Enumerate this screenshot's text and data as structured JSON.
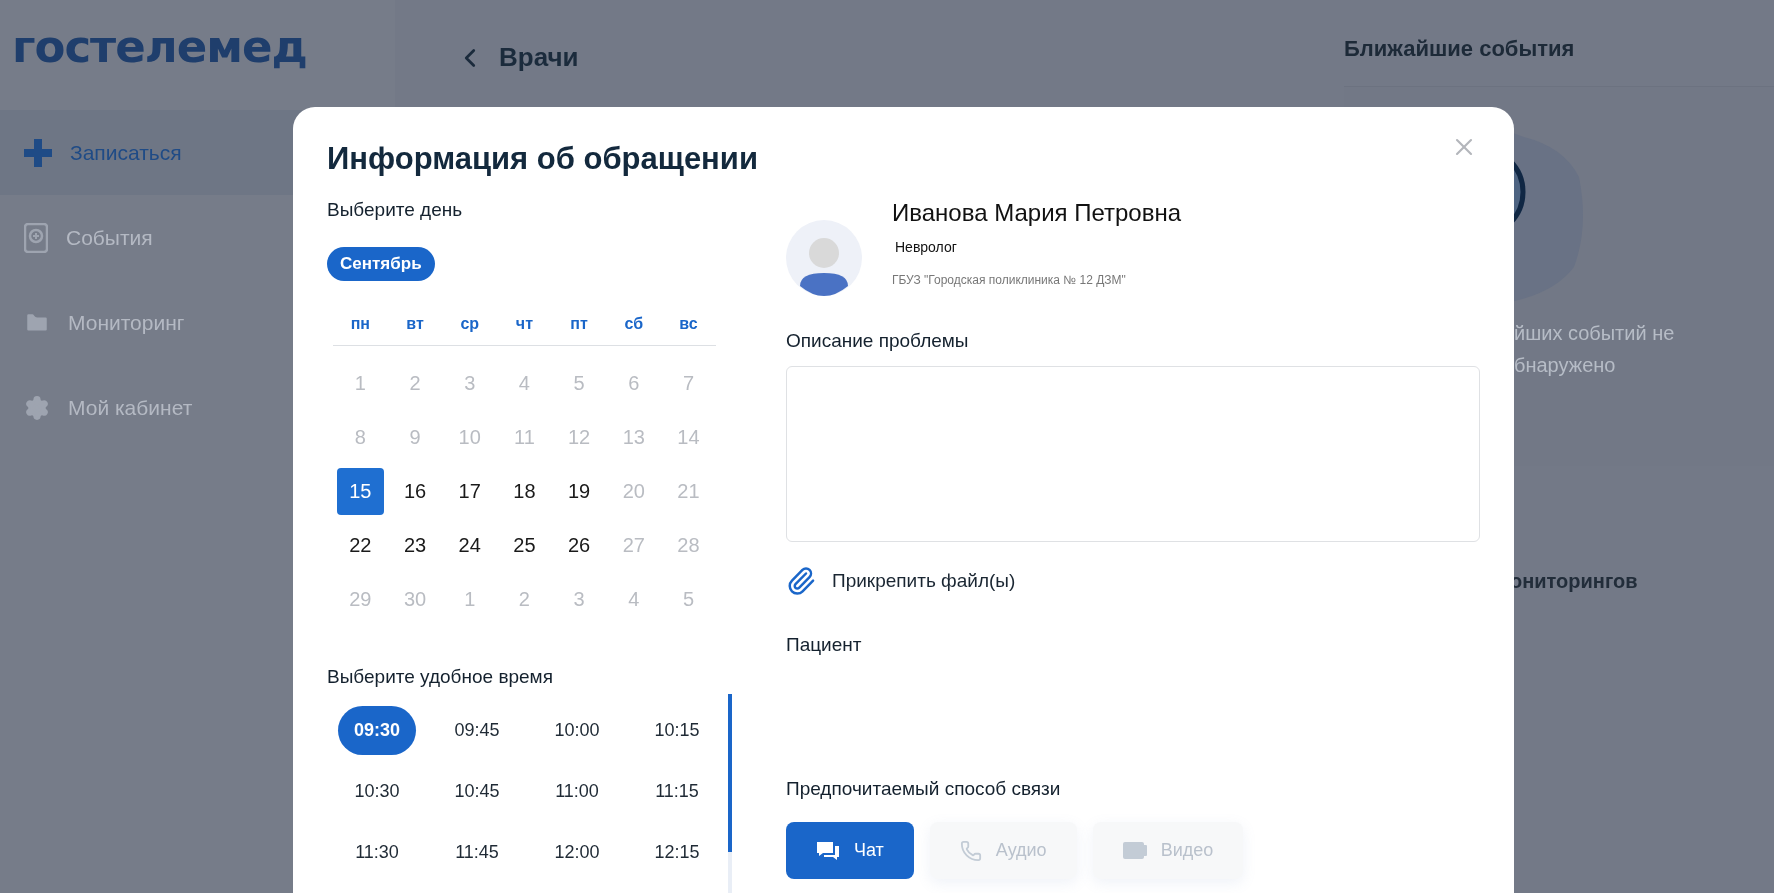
{
  "sidebar": {
    "logo": "гостелемед",
    "items": [
      {
        "label": "Записаться",
        "selected": true
      },
      {
        "label": "События",
        "selected": false
      },
      {
        "label": "Мониторинг",
        "selected": false
      },
      {
        "label": "Мой кабинет",
        "selected": false
      }
    ]
  },
  "header": {
    "title": "Врачи"
  },
  "events_panel": {
    "title": "Ближайшие события",
    "empty_text_lines": [
      "йших событий не",
      "бнаружено"
    ],
    "section_2_title": "ониторингов"
  },
  "modal": {
    "title": "Информация об обращении",
    "day_section": {
      "label": "Выберите день",
      "month": "Сентябрь",
      "weekdays": [
        "пн",
        "вт",
        "ср",
        "чт",
        "пт",
        "сб",
        "вс"
      ],
      "days": [
        {
          "label": "1",
          "available": false,
          "selected": false
        },
        {
          "label": "2",
          "available": false,
          "selected": false
        },
        {
          "label": "3",
          "available": false,
          "selected": false
        },
        {
          "label": "4",
          "available": false,
          "selected": false
        },
        {
          "label": "5",
          "available": false,
          "selected": false
        },
        {
          "label": "6",
          "available": false,
          "selected": false
        },
        {
          "label": "7",
          "available": false,
          "selected": false
        },
        {
          "label": "8",
          "available": false,
          "selected": false
        },
        {
          "label": "9",
          "available": false,
          "selected": false
        },
        {
          "label": "10",
          "available": false,
          "selected": false
        },
        {
          "label": "11",
          "available": false,
          "selected": false
        },
        {
          "label": "12",
          "available": false,
          "selected": false
        },
        {
          "label": "13",
          "available": false,
          "selected": false
        },
        {
          "label": "14",
          "available": false,
          "selected": false
        },
        {
          "label": "15",
          "available": true,
          "selected": true
        },
        {
          "label": "16",
          "available": true,
          "selected": false
        },
        {
          "label": "17",
          "available": true,
          "selected": false
        },
        {
          "label": "18",
          "available": true,
          "selected": false
        },
        {
          "label": "19",
          "available": true,
          "selected": false
        },
        {
          "label": "20",
          "available": false,
          "selected": false
        },
        {
          "label": "21",
          "available": false,
          "selected": false
        },
        {
          "label": "22",
          "available": true,
          "selected": false
        },
        {
          "label": "23",
          "available": true,
          "selected": false
        },
        {
          "label": "24",
          "available": true,
          "selected": false
        },
        {
          "label": "25",
          "available": true,
          "selected": false
        },
        {
          "label": "26",
          "available": true,
          "selected": false
        },
        {
          "label": "27",
          "available": false,
          "selected": false
        },
        {
          "label": "28",
          "available": false,
          "selected": false
        },
        {
          "label": "29",
          "available": false,
          "selected": false
        },
        {
          "label": "30",
          "available": false,
          "selected": false
        },
        {
          "label": "1",
          "available": false,
          "selected": false
        },
        {
          "label": "2",
          "available": false,
          "selected": false
        },
        {
          "label": "3",
          "available": false,
          "selected": false
        },
        {
          "label": "4",
          "available": false,
          "selected": false
        },
        {
          "label": "5",
          "available": false,
          "selected": false
        }
      ]
    },
    "time_section": {
      "label": "Выберите удобное время",
      "slots": [
        {
          "label": "09:30",
          "selected": true
        },
        {
          "label": "09:45",
          "selected": false
        },
        {
          "label": "10:00",
          "selected": false
        },
        {
          "label": "10:15",
          "selected": false
        },
        {
          "label": "10:30",
          "selected": false
        },
        {
          "label": "10:45",
          "selected": false
        },
        {
          "label": "11:00",
          "selected": false
        },
        {
          "label": "11:15",
          "selected": false
        },
        {
          "label": "11:30",
          "selected": false
        },
        {
          "label": "11:45",
          "selected": false
        },
        {
          "label": "12:00",
          "selected": false
        },
        {
          "label": "12:15",
          "selected": false
        }
      ]
    },
    "doctor": {
      "name": "Иванова Мария Петровна",
      "specialty": "Невролог",
      "clinic": "ГБУЗ \"Городская поликлиника № 12 ДЗМ\""
    },
    "problem": {
      "label": "Описание проблемы"
    },
    "attach": {
      "label": "Прикрепить файл(ы)"
    },
    "patient": {
      "label": "Пациент"
    },
    "contact": {
      "label": "Предпочитаемый способ связи",
      "options": [
        {
          "label": "Чат",
          "kind": "chat",
          "selected": true
        },
        {
          "label": "Аудио",
          "kind": "audio",
          "selected": false
        },
        {
          "label": "Видео",
          "kind": "video",
          "selected": false
        }
      ]
    }
  }
}
